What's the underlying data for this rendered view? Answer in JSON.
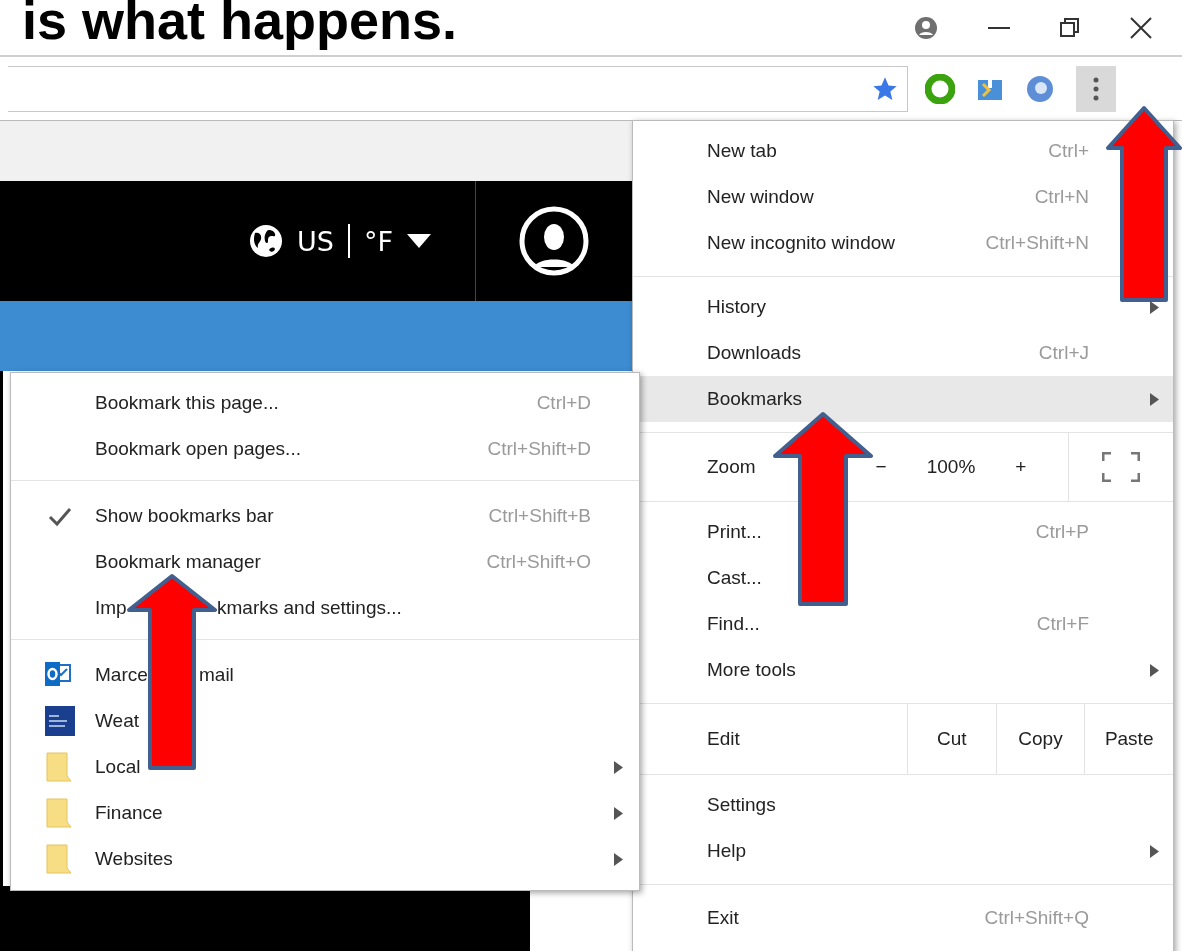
{
  "slide_title": "is what happens.",
  "page_header": {
    "region": "US",
    "unit": "°F"
  },
  "menu": {
    "sections": [
      {
        "items": [
          {
            "kind": "item",
            "label": "New tab",
            "shortcut": "Ctrl+",
            "selected": false
          },
          {
            "kind": "item",
            "label": "New window",
            "shortcut": "Ctrl+N",
            "selected": false
          },
          {
            "kind": "item",
            "label": "New incognito window",
            "shortcut": "Ctrl+Shift+N",
            "selected": false
          }
        ]
      },
      {
        "items": [
          {
            "kind": "item",
            "label": "History",
            "submenu": true,
            "selected": false
          },
          {
            "kind": "item",
            "label": "Downloads",
            "shortcut": "Ctrl+J",
            "selected": false
          },
          {
            "kind": "item",
            "label": "Bookmarks",
            "submenu": true,
            "selected": true
          }
        ]
      },
      {
        "items": [
          {
            "kind": "zoom",
            "label": "Zoom",
            "minus": "−",
            "level": "100%",
            "plus": "+"
          }
        ]
      },
      {
        "items": [
          {
            "kind": "item",
            "label": "Print...",
            "shortcut": "Ctrl+P",
            "selected": false
          },
          {
            "kind": "item",
            "label": "Cast...",
            "selected": false
          },
          {
            "kind": "item",
            "label": "Find...",
            "shortcut": "Ctrl+F",
            "selected": false
          },
          {
            "kind": "item",
            "label": "More tools",
            "submenu": true,
            "selected": false
          }
        ]
      },
      {
        "items": [
          {
            "kind": "edit",
            "label": "Edit",
            "actions": [
              "Cut",
              "Copy",
              "Paste"
            ]
          }
        ]
      },
      {
        "items": [
          {
            "kind": "item",
            "label": "Settings",
            "selected": false
          },
          {
            "kind": "item",
            "label": "Help",
            "submenu": true,
            "selected": false
          }
        ]
      },
      {
        "items": [
          {
            "kind": "item",
            "label": "Exit",
            "shortcut": "Ctrl+Shift+Q",
            "selected": false
          }
        ]
      }
    ]
  },
  "bookmarks_menu": {
    "sections": [
      {
        "items": [
          {
            "kind": "command",
            "label": "Bookmark this page...",
            "shortcut": "Ctrl+D",
            "checked": false
          },
          {
            "kind": "command",
            "label": "Bookmark open pages...",
            "shortcut": "Ctrl+Shift+D",
            "checked": false
          }
        ]
      },
      {
        "items": [
          {
            "kind": "command",
            "label": "Show bookmarks bar",
            "shortcut": "Ctrl+Shift+B",
            "checked": true
          },
          {
            "kind": "command",
            "label": "Bookmark manager",
            "shortcut": "Ctrl+Shift+O",
            "checked": false
          },
          {
            "kind": "command",
            "parts": [
              "Imp",
              "kmarks and settings..."
            ],
            "checked": false
          }
        ]
      },
      {
        "items": [
          {
            "kind": "mail",
            "parts": [
              "Marce",
              "mail"
            ],
            "checked": false
          },
          {
            "kind": "weather",
            "label": "Weat",
            "checked": false
          },
          {
            "kind": "folder",
            "label": "Local",
            "submenu": true,
            "checked": false
          },
          {
            "kind": "folder",
            "label": "Finance",
            "submenu": true,
            "checked": false
          },
          {
            "kind": "folder",
            "label": "Websites",
            "submenu": true,
            "checked": false
          }
        ]
      }
    ]
  }
}
